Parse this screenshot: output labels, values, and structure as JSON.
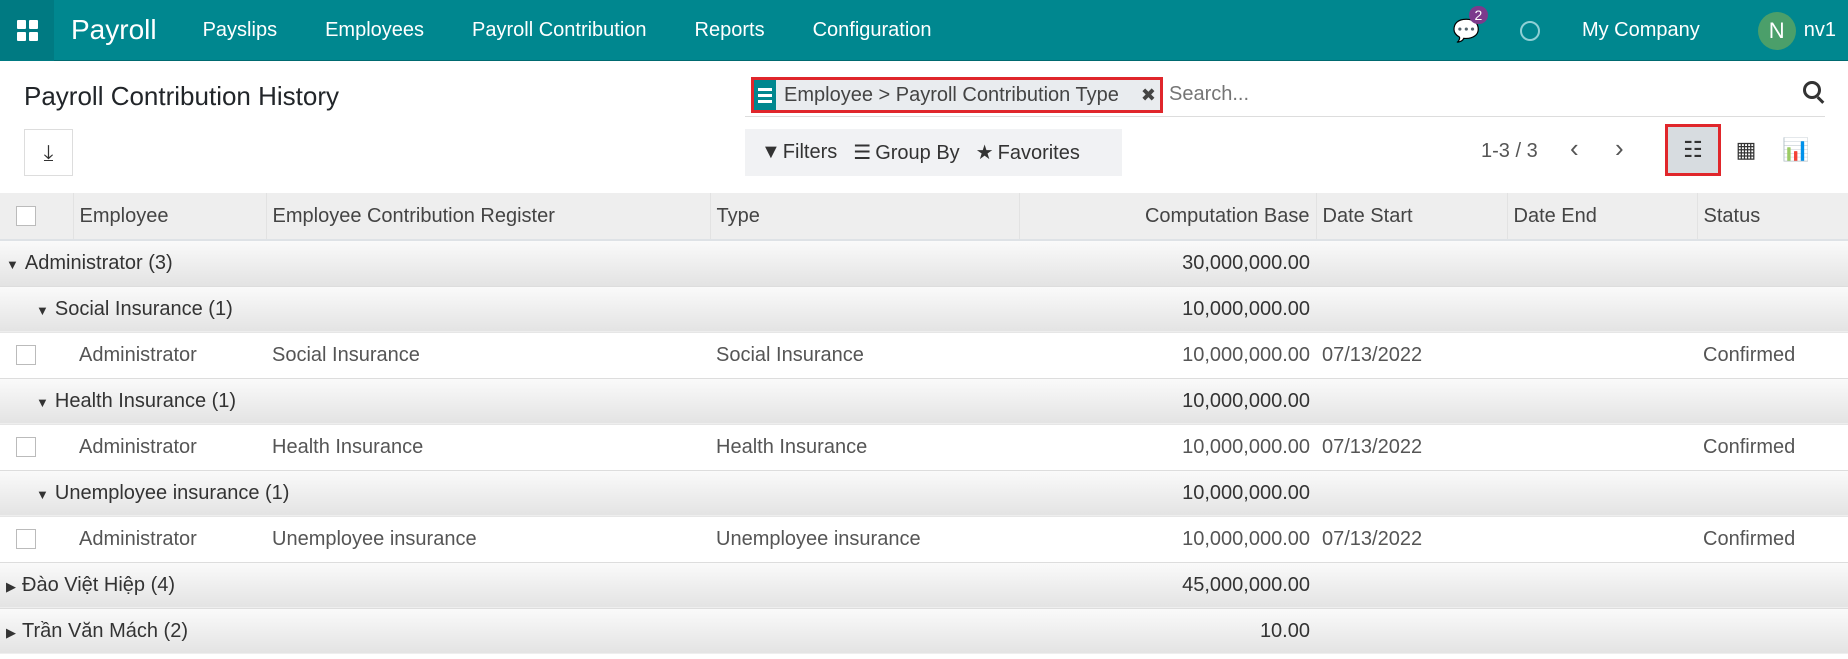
{
  "nav": {
    "brand": "Payroll",
    "menus": [
      "Payslips",
      "Employees",
      "Payroll Contribution",
      "Reports",
      "Configuration"
    ],
    "chat_count": "2",
    "company": "My Company",
    "avatar_initial": "N",
    "user": "nv1"
  },
  "page": {
    "title": "Payroll Contribution History"
  },
  "search": {
    "facet": "Employee  > Payroll Contribution Type",
    "placeholder": "Search..."
  },
  "filters": {
    "filters": "Filters",
    "group_by": "Group By",
    "favorites": "Favorites"
  },
  "pager": {
    "value": "1-3 / 3"
  },
  "table": {
    "headers": [
      "Employee",
      "Employee Contribution Register",
      "Type",
      "Computation Base",
      "Date Start",
      "Date End",
      "Status"
    ],
    "rows": [
      {
        "kind": "group",
        "level": 0,
        "open": true,
        "label": "Administrator (3)",
        "base": "30,000,000.00"
      },
      {
        "kind": "group",
        "level": 1,
        "open": true,
        "label": "Social Insurance (1)",
        "base": "10,000,000.00"
      },
      {
        "kind": "record",
        "employee": "Administrator",
        "register": "Social Insurance",
        "type": "Social Insurance",
        "base": "10,000,000.00",
        "date_start": "07/13/2022",
        "date_end": "",
        "status": "Confirmed"
      },
      {
        "kind": "group",
        "level": 1,
        "open": true,
        "label": "Health Insurance (1)",
        "base": "10,000,000.00"
      },
      {
        "kind": "record",
        "employee": "Administrator",
        "register": "Health Insurance",
        "type": "Health Insurance",
        "base": "10,000,000.00",
        "date_start": "07/13/2022",
        "date_end": "",
        "status": "Confirmed"
      },
      {
        "kind": "group",
        "level": 1,
        "open": true,
        "label": "Unemployee insurance (1)",
        "base": "10,000,000.00"
      },
      {
        "kind": "record",
        "employee": "Administrator",
        "register": "Unemployee insurance",
        "type": "Unemployee insurance",
        "base": "10,000,000.00",
        "date_start": "07/13/2022",
        "date_end": "",
        "status": "Confirmed"
      },
      {
        "kind": "group",
        "level": 0,
        "open": false,
        "label": "Đào Việt Hiệp (4)",
        "base": "45,000,000.00"
      },
      {
        "kind": "group",
        "level": 0,
        "open": false,
        "label": "Trần Văn Mách (2)",
        "base": "10.00"
      }
    ]
  }
}
